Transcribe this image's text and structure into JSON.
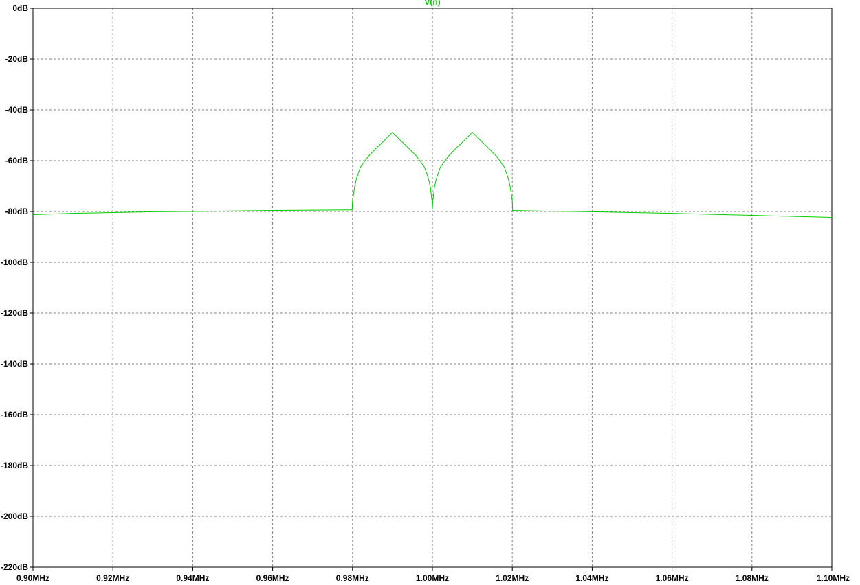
{
  "chart_data": {
    "type": "line",
    "title": "",
    "xlabel": "",
    "ylabel": "",
    "xlim": [
      0.9,
      1.1
    ],
    "ylim": [
      -220,
      0
    ],
    "x_unit": "MHz",
    "y_unit": "dB",
    "grid": true,
    "x_ticks": [
      "0.90MHz",
      "0.92MHz",
      "0.94MHz",
      "0.96MHz",
      "0.98MHz",
      "1.00MHz",
      "1.02MHz",
      "1.04MHz",
      "1.06MHz",
      "1.08MHz",
      "1.10MHz"
    ],
    "x_tick_values": [
      0.9,
      0.92,
      0.94,
      0.96,
      0.98,
      1.0,
      1.02,
      1.04,
      1.06,
      1.08,
      1.1
    ],
    "y_ticks": [
      "0dB",
      "-20dB",
      "-40dB",
      "-60dB",
      "-80dB",
      "-100dB",
      "-120dB",
      "-140dB",
      "-160dB",
      "-180dB",
      "-200dB",
      "-220dB"
    ],
    "y_tick_values": [
      0,
      -20,
      -40,
      -60,
      -80,
      -100,
      -120,
      -140,
      -160,
      -180,
      -200,
      -220
    ],
    "series": [
      {
        "name": "V(n)",
        "color": "#00cc00",
        "x": [
          0.9,
          0.91,
          0.92,
          0.93,
          0.94,
          0.95,
          0.96,
          0.97,
          0.9799,
          0.98,
          0.9805,
          0.981,
          0.982,
          0.984,
          0.986,
          0.988,
          0.99,
          0.992,
          0.994,
          0.996,
          0.998,
          0.999,
          0.9995,
          0.9999,
          1.0,
          1.0001,
          1.0005,
          1.001,
          1.002,
          1.004,
          1.006,
          1.008,
          1.01,
          1.012,
          1.014,
          1.016,
          1.018,
          1.019,
          1.0195,
          1.02,
          1.0201,
          1.03,
          1.04,
          1.05,
          1.06,
          1.07,
          1.08,
          1.09,
          1.1
        ],
        "y": [
          -81.2,
          -80.7,
          -80.4,
          -80.1,
          -80.0,
          -79.8,
          -79.6,
          -79.5,
          -79.4,
          -76.0,
          -70.5,
          -67.0,
          -62.5,
          -58.2,
          -55.0,
          -52.0,
          -48.8,
          -52.0,
          -55.0,
          -58.2,
          -62.5,
          -67.0,
          -70.5,
          -76.0,
          -79.0,
          -76.0,
          -70.5,
          -67.0,
          -62.5,
          -58.2,
          -55.0,
          -52.0,
          -48.8,
          -52.0,
          -55.0,
          -58.2,
          -62.5,
          -67.0,
          -70.5,
          -76.0,
          -79.6,
          -79.9,
          -80.1,
          -80.4,
          -80.7,
          -81.1,
          -81.5,
          -81.9,
          -82.3
        ]
      }
    ]
  }
}
